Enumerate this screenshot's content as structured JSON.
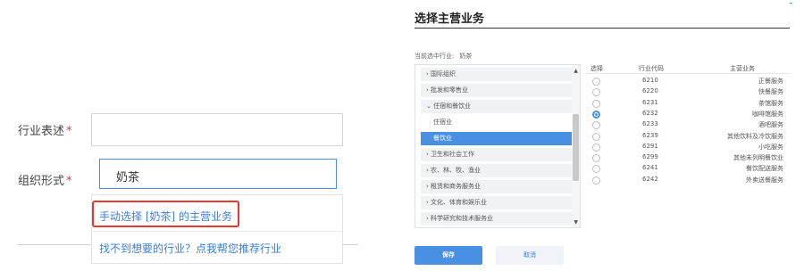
{
  "form": {
    "industry_label": "行业表述",
    "org_label": "组织形式",
    "required_mark": "*",
    "industry_value": "",
    "org_value": "奶茶"
  },
  "dropdown": {
    "manual_select": "手动选择 [奶茶] 的主营业务",
    "recommend": "找不到想要的行业？点我帮您推荐行业"
  },
  "panel": {
    "title": "选择主营业务",
    "current_label": "当前选中行业:",
    "current_value": "奶茶"
  },
  "tree": [
    {
      "label": "› 国际组织",
      "level": 0,
      "selected": false
    },
    {
      "label": "› 批发和零售业",
      "level": 0,
      "selected": false
    },
    {
      "label": "⌄ 住宿和餐饮业",
      "level": 0,
      "selected": false
    },
    {
      "label": "住宿业",
      "level": 1,
      "selected": false
    },
    {
      "label": "餐饮业",
      "level": 1,
      "selected": true
    },
    {
      "label": "› 卫生和社会工作",
      "level": 0,
      "selected": false
    },
    {
      "label": "› 农、林、牧、渔业",
      "level": 0,
      "selected": false
    },
    {
      "label": "› 租赁和商务服务业",
      "level": 0,
      "selected": false
    },
    {
      "label": "› 文化、体育和娱乐业",
      "level": 0,
      "selected": false
    },
    {
      "label": "› 科学研究和技术服务业",
      "level": 0,
      "selected": false
    }
  ],
  "table": {
    "headers": {
      "select": "选择",
      "code": "行业代码",
      "business": "主营业务"
    },
    "rows": [
      {
        "code": "6210",
        "name": "正餐服务",
        "checked": false
      },
      {
        "code": "6220",
        "name": "快餐服务",
        "checked": false
      },
      {
        "code": "6231",
        "name": "茶馆服务",
        "checked": false
      },
      {
        "code": "6232",
        "name": "咖啡馆服务",
        "checked": true
      },
      {
        "code": "6233",
        "name": "酒吧服务",
        "checked": false
      },
      {
        "code": "6239",
        "name": "其他饮料及冷饮服务",
        "checked": false
      },
      {
        "code": "6291",
        "name": "小吃服务",
        "checked": false
      },
      {
        "code": "6299",
        "name": "其他未列明餐饮业",
        "checked": false
      },
      {
        "code": "6241",
        "name": "餐饮配送服务",
        "checked": false
      },
      {
        "code": "6242",
        "name": "外卖送餐服务",
        "checked": false
      }
    ]
  },
  "buttons": {
    "save": "保存",
    "cancel": "取消"
  },
  "colors": {
    "accent": "#4a90e2",
    "required": "#e53935",
    "link": "#3a7fd5"
  }
}
